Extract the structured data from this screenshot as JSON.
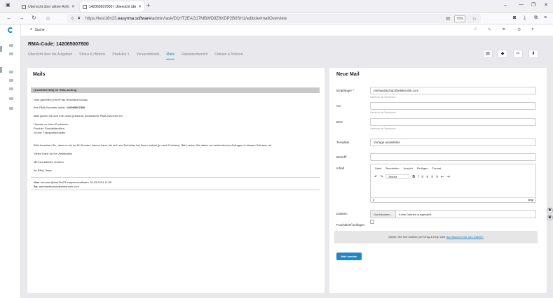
{
  "browser": {
    "tabs": [
      {
        "title": "Übersicht über aktive Anfragen"
      },
      {
        "title": "142065007800 | Übersicht über …"
      }
    ],
    "new_tab": "+",
    "url": {
      "host_prefix": "https://test16n23.",
      "host": "easyrma.software",
      "path": "/admin/task/D1HT2EAG17MBWD9Z8XDP2B0SH1/edit/de#mailOverview"
    },
    "zoom": "70%"
  },
  "app": {
    "search_placeholder": "Suche",
    "rma_title": "RMA-Code: 142065007800",
    "tabs": [
      "Übersicht über die Aufgaben",
      "Status & Historie",
      "Produkte 1",
      "Versanddetails",
      "Mails",
      "Reparaturbericht",
      "Dateien & Notizen"
    ],
    "active_tab": "Mails"
  },
  "mails": {
    "heading": "Mails",
    "subject": "[142065007800] Ihr RMA-Auftrag",
    "greeting": "Sehr geehrte(r) Herr/Frau Reinhardt Schulz,",
    "rma_line_prefix": "Ihre RMA-Nummer lautet:",
    "rma_number": "142065007800",
    "note": "Bitte geben Sie dort Ihre oben genannte, persönliche RMA-Nummer ein.",
    "info_title": "Hinweis zu Ihren Produkten:",
    "product": "Produkt: Flachbildschirm",
    "reason": "Grund: Transportschaden",
    "notice": "Bitte beachten Sie, dass es bis zu 48 Stunden dauern kann, bis sich ein Techniker bei Ihnen meldet (je nach Problem). Bitte sehen Sie daher von telefonischen Anfragen in diesem Zeitraum ab.",
    "thanks": "Vielen Dank für Ihr Verständnis",
    "regards": "Mit freundlichen Grüßen",
    "team": "Ihr RMA-Team",
    "from_label": "Von:",
    "from": "retouren@test16n23.easyrma.software 26.03.2024 12:50",
    "to_label": "An:",
    "to": "reinhardtschulz@elektronik.com"
  },
  "new_mail": {
    "heading": "Neue Mail",
    "recipient_label": "Empfänger",
    "recipient_value": "reinhardtschulz@elektronik.com",
    "hint": "Getrennt mit Semikolon",
    "cc_label": "CC",
    "bcc_label": "BCC",
    "template_label": "Template",
    "template_placeholder": "Vorlage auswählen",
    "subject_label": "Betreff",
    "content_label": "Inhalt",
    "editor_menu": [
      "Datei",
      "Bearbeiten",
      "Ansicht",
      "Einfügen",
      "Format"
    ],
    "format_value": "Absatz",
    "status_path": "p",
    "tiny": "tiny",
    "files_label": "Dateien",
    "browse": "Durchsuchen...",
    "no_file": "Keine Dateien ausgewählt.",
    "letter_label": "Frachtbrief beifügen",
    "drop_text": "Ziehen Sie Ihre Dateien per Drag & Drop oder",
    "drop_link": "durchsuchen Sie Ihre Dateien",
    "send_button": "Mail senden"
  }
}
